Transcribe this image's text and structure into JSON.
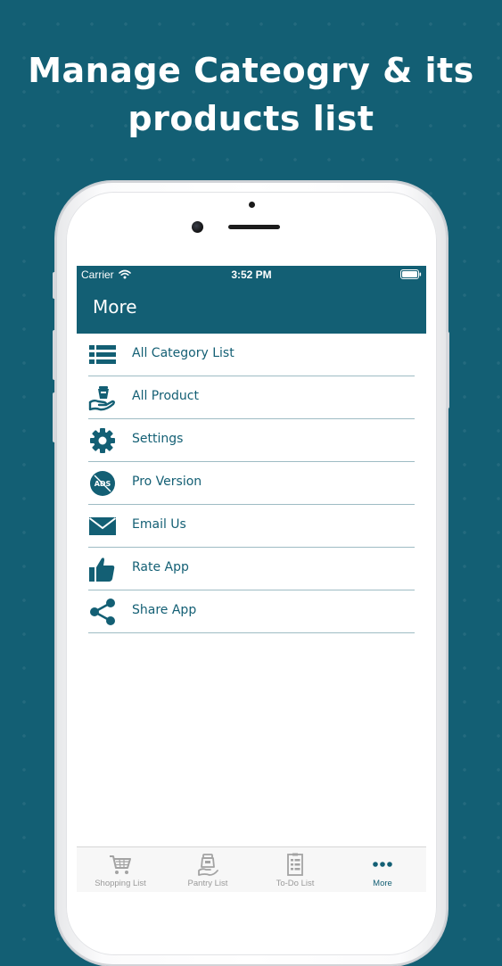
{
  "headline": {
    "line1": "Manage Cateogry & its",
    "line2": "products list"
  },
  "status_bar": {
    "carrier": "Carrier",
    "time": "3:52 PM",
    "wifi_icon": "wifi-icon",
    "battery_icon": "battery-icon"
  },
  "nav": {
    "title": "More"
  },
  "menu": {
    "items": [
      {
        "label": "All Category List",
        "icon": "list-icon"
      },
      {
        "label": "All Product",
        "icon": "product-hand-icon"
      },
      {
        "label": "Settings",
        "icon": "gear-icon"
      },
      {
        "label": "Pro Version",
        "icon": "no-ads-icon"
      },
      {
        "label": "Email Us",
        "icon": "envelope-icon"
      },
      {
        "label": "Rate App",
        "icon": "thumbs-up-icon"
      },
      {
        "label": "Share App",
        "icon": "share-icon"
      }
    ]
  },
  "tab_bar": {
    "tabs": [
      {
        "label": "Shopping List",
        "icon": "cart-icon",
        "active": false
      },
      {
        "label": "Pantry List",
        "icon": "pantry-icon",
        "active": false
      },
      {
        "label": "To-Do List",
        "icon": "todo-list-icon",
        "active": false
      },
      {
        "label": "More",
        "icon": "more-dots-icon",
        "active": true
      }
    ]
  },
  "colors": {
    "brand": "#135f74",
    "divider": "#9ebcc4",
    "tab_inactive": "#9a9a9a",
    "tab_bar_bg": "#f7f7f7"
  }
}
